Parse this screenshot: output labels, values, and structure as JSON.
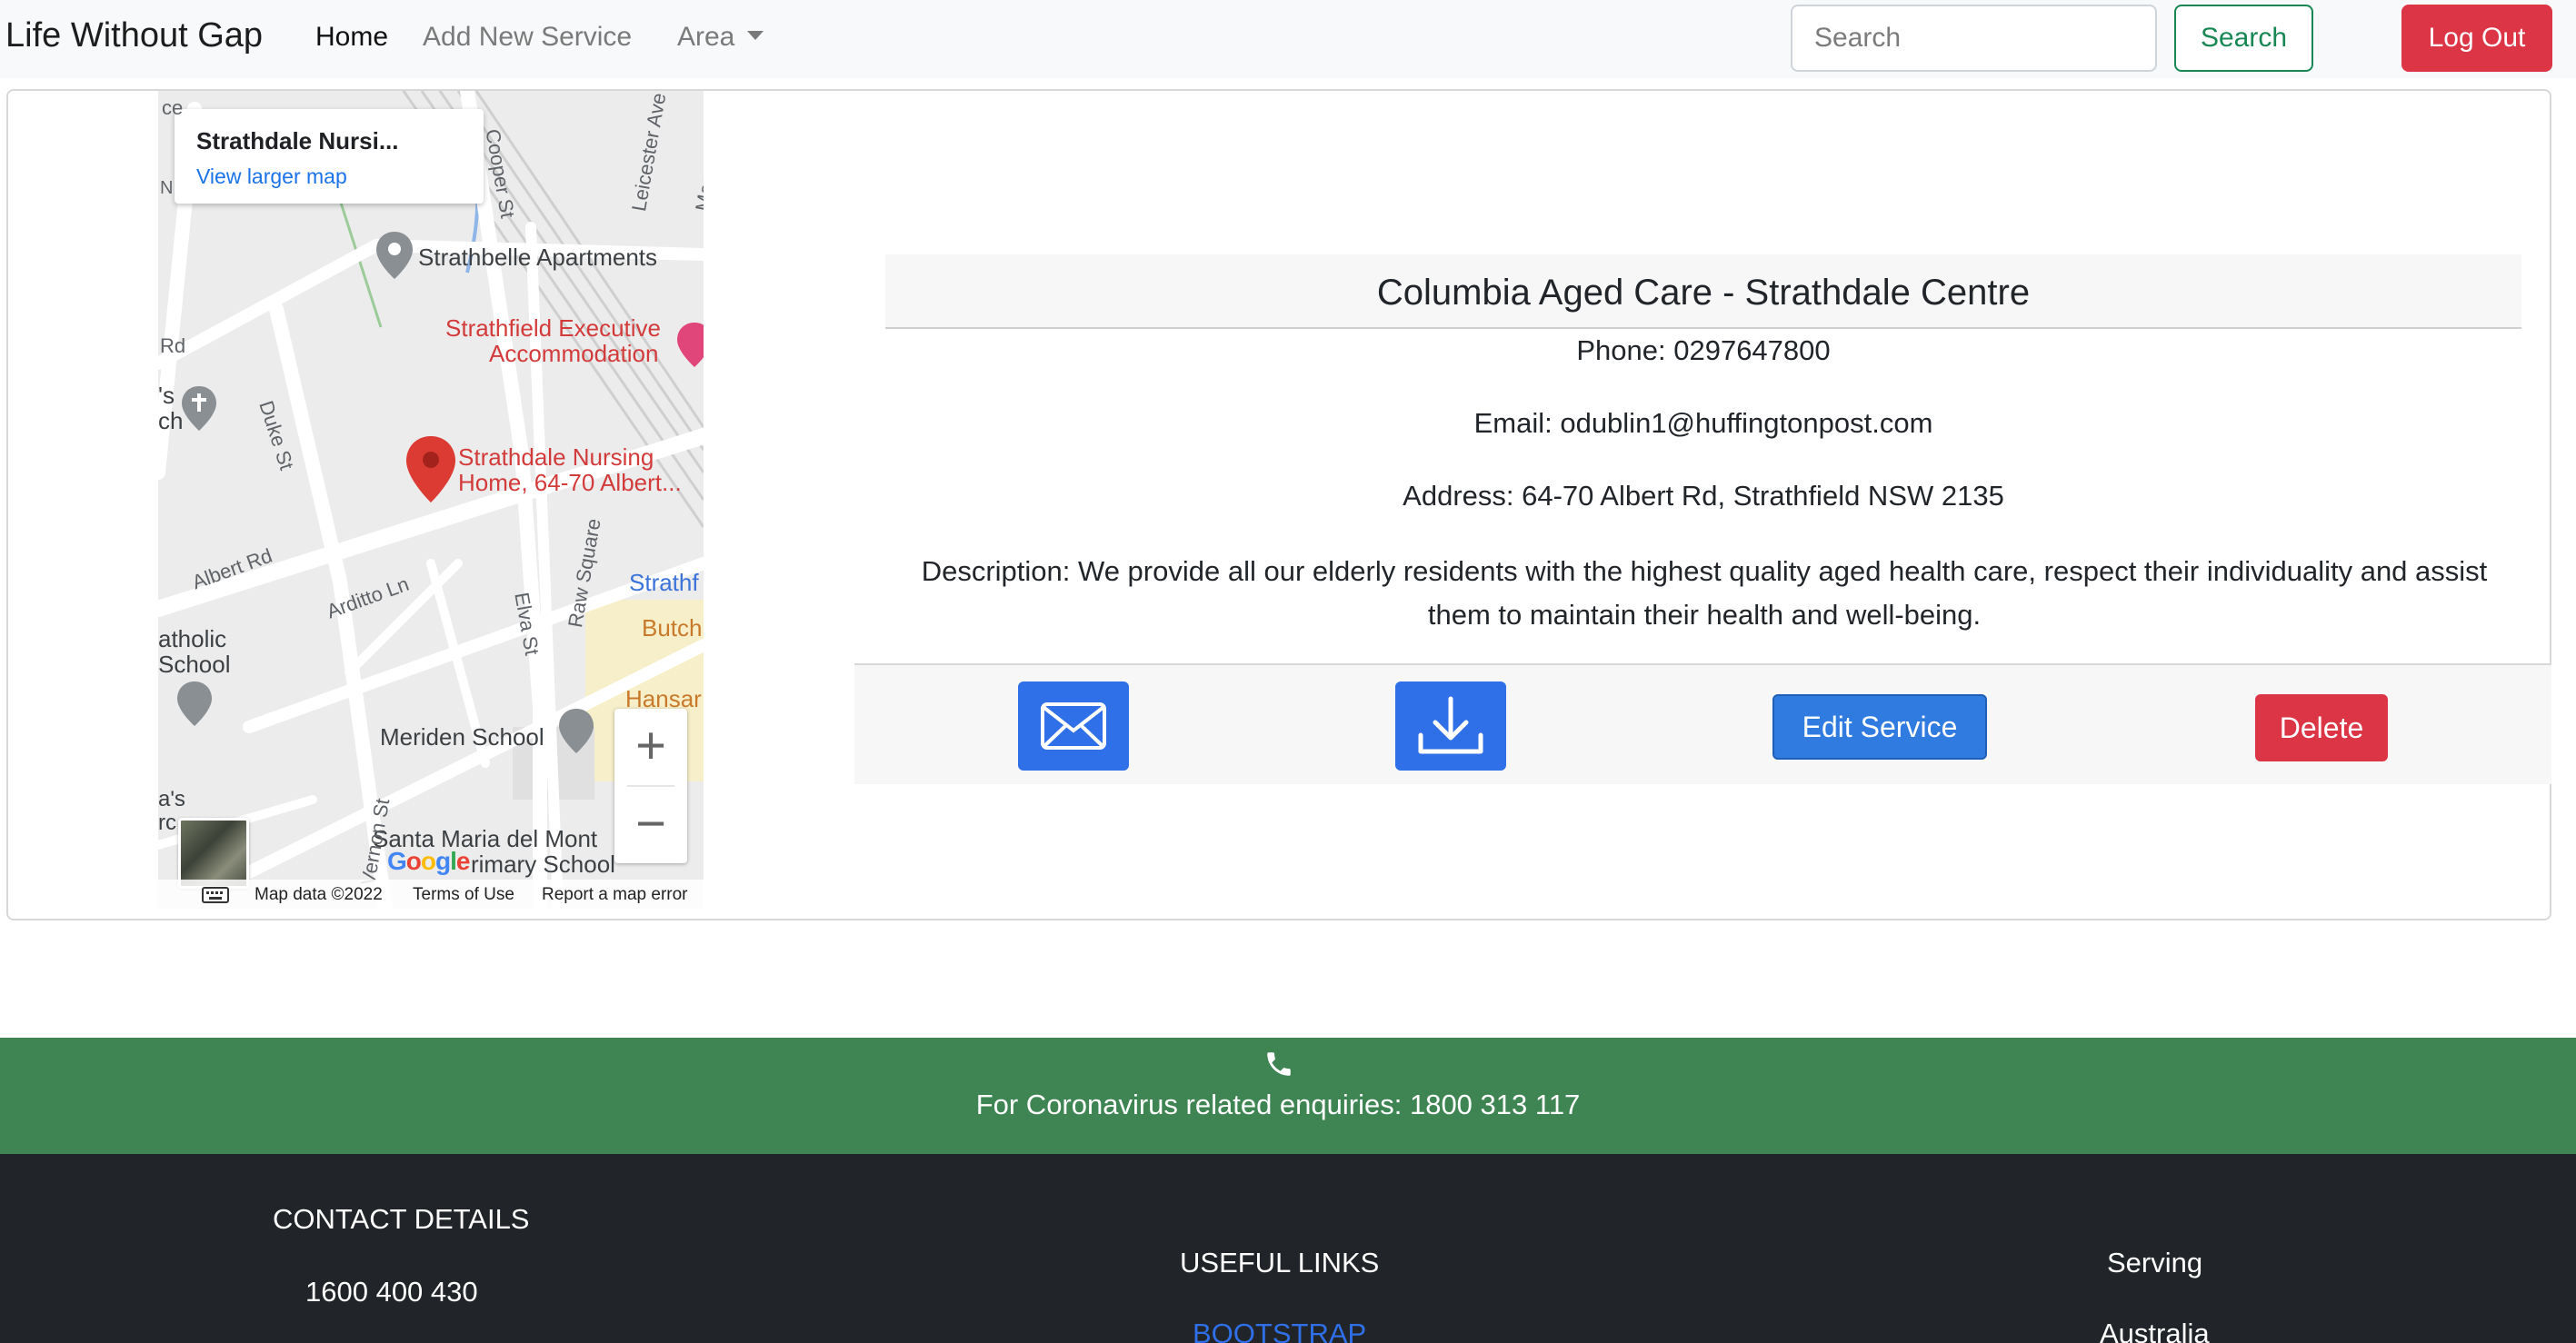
{
  "navbar": {
    "brand": "Life Without Gap",
    "home": "Home",
    "add_service": "Add New Service",
    "area": "Area",
    "search_placeholder": "Search",
    "search_button": "Search",
    "logout_button": "Log Out"
  },
  "map": {
    "info_title": "Strathdale Nursi...",
    "info_link": "View larger map",
    "labels": {
      "strathbelle": "Strathbelle Apartments",
      "strathfield_exec_1": "Strathfield Executive",
      "strathfield_exec_2": "Accommodation",
      "strathdale_1": "Strathdale Nursing",
      "strathdale_2": "Home, 64-70 Albert...",
      "catholic_1": "atholic",
      "catholic_2": "School",
      "meriden": "Meriden School",
      "strathf": "Strathf",
      "butch": "Butch",
      "hansa": "Hansar",
      "santa_maria_1": "Santa Maria del Mont",
      "santa_maria_2": "rimary School",
      "church_1": "'s",
      "church_2": "ch",
      "rd": "Rd",
      "ce": "ce",
      "n": "N",
      "as": "a's",
      "rc": "rc"
    },
    "streets": {
      "cooper": "Cooper St",
      "leicester": "Leicester Ave",
      "mar": "Mar",
      "duke": "Duke St",
      "albert": "Albert Rd",
      "arditto": "Arditto Ln",
      "raw_square": "Raw Square",
      "elva": "Elva St",
      "vernon": "Vernon St"
    },
    "zoom_in": "+",
    "zoom_out": "−",
    "google": [
      "G",
      "o",
      "o",
      "g",
      "l",
      "e"
    ],
    "footer_data": "Map data ©2022",
    "footer_terms": "Terms of Use",
    "footer_report": "Report a map error"
  },
  "service": {
    "title": "Columbia Aged Care - Strathdale Centre",
    "phone": "Phone: 0297647800",
    "email": "Email: odublin1@huffingtonpost.com",
    "address": "Address: 64-70 Albert Rd, Strathfield NSW 2135",
    "description": "Description: We provide all our elderly residents with the highest quality aged health care, respect their individuality and assist them to maintain their health and well-being.",
    "edit_button": "Edit Service",
    "delete_button": "Delete"
  },
  "footer": {
    "corona": "For Coronavirus related enquiries: 1800 313 117",
    "contact_heading": "CONTACT DETAILS",
    "contact_phone": "1600 400 430",
    "links_heading": "USEFUL LINKS",
    "link_bootstrap": "BOOTSTRAP",
    "serving_heading": "Serving",
    "serving_value": "Australia"
  },
  "colors": {
    "accent_blue": "#2f6fe8",
    "success_green": "#198754",
    "danger_red": "#dc3545",
    "band_green": "#3e8553",
    "footer_dark": "#212529"
  }
}
